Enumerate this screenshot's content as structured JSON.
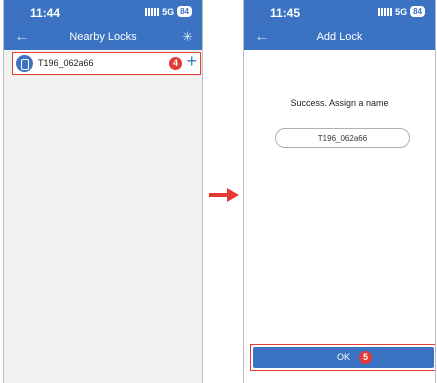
{
  "screen1": {
    "status": {
      "time": "11:44",
      "network": "5G",
      "battery": "84"
    },
    "title": "Nearby Locks",
    "lock_item": {
      "name": "T196_062a66",
      "step": "4",
      "add_symbol": "+"
    }
  },
  "screen2": {
    "status": {
      "time": "11:45",
      "network": "5G",
      "battery": "84"
    },
    "title": "Add Lock",
    "message": "Success. Assign a name",
    "name_value": "T196_062a66",
    "ok_label": "OK",
    "step": "5"
  },
  "colors": {
    "primary": "#3b73c2",
    "highlight": "#e53935"
  },
  "icons": [
    "back-arrow-icon",
    "scan-icon",
    "lock-icon",
    "plus-icon",
    "signal-icon",
    "arrow-right-icon"
  ]
}
